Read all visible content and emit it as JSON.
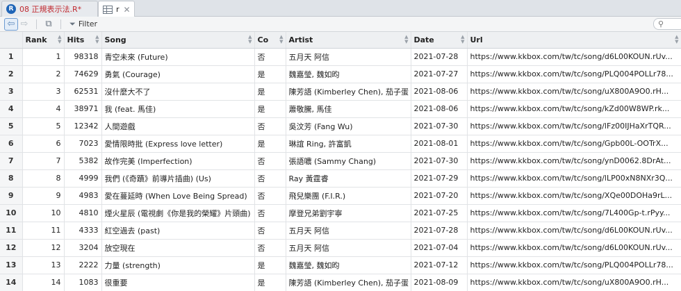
{
  "tabs": [
    {
      "label": "08 正規表示法.R*",
      "icon": "r-script-icon"
    },
    {
      "label": "r",
      "icon": "data-grid-icon"
    }
  ],
  "toolbar": {
    "filter_label": "Filter"
  },
  "columns": [
    "Rank",
    "Hits",
    "Song",
    "Co",
    "Artist",
    "Date",
    "Url"
  ],
  "rows": [
    {
      "n": "1",
      "rank": "1",
      "hits": "98318",
      "song": "青空未來 (Future)",
      "co": "否",
      "artist": "五月天 阿信",
      "date": "2021-07-28",
      "url": "https://www.kkbox.com/tw/tc/song/d6L00KOUN.rUv..."
    },
    {
      "n": "2",
      "rank": "2",
      "hits": "74629",
      "song": "勇氣 (Courage)",
      "co": "是",
      "artist": "魏嘉瑩, 魏如昀",
      "date": "2021-07-27",
      "url": "https://www.kkbox.com/tw/tc/song/PLQ004POLLr78..."
    },
    {
      "n": "3",
      "rank": "3",
      "hits": "62531",
      "song": "沒什麼大不了",
      "co": "是",
      "artist": "陳芳語 (Kimberley Chen), 茄子蛋",
      "date": "2021-08-06",
      "url": "https://www.kkbox.com/tw/tc/song/uX800A9O0.rH..."
    },
    {
      "n": "4",
      "rank": "4",
      "hits": "38971",
      "song": "我 (feat. 馬佳)",
      "co": "是",
      "artist": "蕭敬騰, 馬佳",
      "date": "2021-08-06",
      "url": "https://www.kkbox.com/tw/tc/song/kZd00W8WP.rk..."
    },
    {
      "n": "5",
      "rank": "5",
      "hits": "12342",
      "song": "人間遊戲",
      "co": "否",
      "artist": "吳汶芳 (Fang Wu)",
      "date": "2021-07-30",
      "url": "https://www.kkbox.com/tw/tc/song/lFz00IJHaXrTQR..."
    },
    {
      "n": "6",
      "rank": "6",
      "hits": "7023",
      "song": "愛情限時批 (Express love letter)",
      "co": "是",
      "artist": "琳誼 Ring, 許富凱",
      "date": "2021-08-01",
      "url": "https://www.kkbox.com/tw/tc/song/Gpb00L-OOTrX..."
    },
    {
      "n": "7",
      "rank": "7",
      "hits": "5382",
      "song": "故作完美 (Imperfection)",
      "co": "否",
      "artist": "張語噥 (Sammy Chang)",
      "date": "2021-07-30",
      "url": "https://www.kkbox.com/tw/tc/song/ynD0062.8DrAt..."
    },
    {
      "n": "8",
      "rank": "8",
      "hits": "4999",
      "song": "我們 (《奇蹟》前導片插曲) (Us)",
      "co": "否",
      "artist": "Ray 黃霆睿",
      "date": "2021-07-29",
      "url": "https://www.kkbox.com/tw/tc/song/lLP00xN8NXr3Q..."
    },
    {
      "n": "9",
      "rank": "9",
      "hits": "4983",
      "song": "愛在蔓延時 (When Love Being Spread)",
      "co": "否",
      "artist": "飛兒樂團 (F.I.R.)",
      "date": "2021-07-20",
      "url": "https://www.kkbox.com/tw/tc/song/XQe00DOHa9rL..."
    },
    {
      "n": "10",
      "rank": "10",
      "hits": "4810",
      "song": "煙火星辰 (電視劇《你是我的榮耀》片頭曲)",
      "co": "否",
      "artist": "摩登兄弟劉宇寧",
      "date": "2021-07-25",
      "url": "https://www.kkbox.com/tw/tc/song/7L400Gp-t.rPyy..."
    },
    {
      "n": "11",
      "rank": "11",
      "hits": "4333",
      "song": "紅空過去 (past)",
      "co": "否",
      "artist": "五月天 阿信",
      "date": "2021-07-28",
      "url": "https://www.kkbox.com/tw/tc/song/d6L00KOUN.rUv..."
    },
    {
      "n": "12",
      "rank": "12",
      "hits": "3204",
      "song": "放空現在",
      "co": "否",
      "artist": "五月天 阿信",
      "date": "2021-07-04",
      "url": "https://www.kkbox.com/tw/tc/song/d6L00KOUN.rUv..."
    },
    {
      "n": "13",
      "rank": "13",
      "hits": "2222",
      "song": "力量 (strength)",
      "co": "是",
      "artist": "魏嘉瑩, 魏如昀",
      "date": "2021-07-12",
      "url": "https://www.kkbox.com/tw/tc/song/PLQ004POLLr78..."
    },
    {
      "n": "14",
      "rank": "14",
      "hits": "1083",
      "song": "很重要",
      "co": "是",
      "artist": "陳芳語 (Kimberley Chen), 茄子蛋",
      "date": "2021-08-09",
      "url": "https://www.kkbox.com/tw/tc/song/uX800A9O0.rH..."
    }
  ]
}
